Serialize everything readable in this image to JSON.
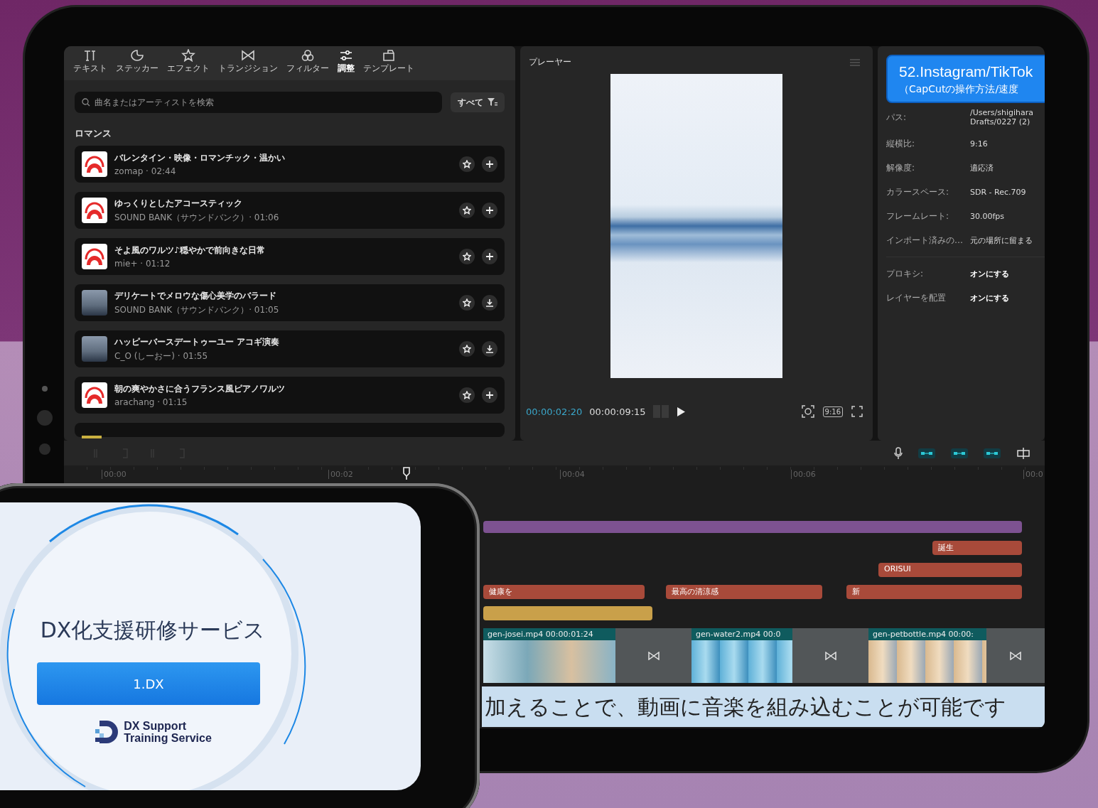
{
  "editor": {
    "tool_tabs": [
      {
        "label": "テキスト",
        "selected": false
      },
      {
        "label": "ステッカー",
        "selected": false
      },
      {
        "label": "エフェクト",
        "selected": false
      },
      {
        "label": "トランジション",
        "selected": false
      },
      {
        "label": "フィルター",
        "selected": false
      },
      {
        "label": "調整",
        "selected": true
      },
      {
        "label": "テンプレート",
        "selected": false
      }
    ],
    "search": {
      "placeholder": "曲名またはアーティストを検索"
    },
    "filter_button": "すべて",
    "category": "ロマンス",
    "tracks": [
      {
        "title": "バレンタイン・映像・ロマンチック・温かい",
        "meta": "zomap · 02:44",
        "kind": "logo",
        "downloaded": true
      },
      {
        "title": "ゆっくりとしたアコースティック",
        "meta": "SOUND BANK（サウンドバンク）· 01:06",
        "kind": "logo",
        "downloaded": true
      },
      {
        "title": "そよ風のワルツ♪穏やかで前向きな日常",
        "meta": "mie+ · 01:12",
        "kind": "logo",
        "downloaded": true
      },
      {
        "title": "デリケートでメロウな傷心美学のバラード",
        "meta": "SOUND BANK（サウンドバンク）· 01:05",
        "kind": "photo",
        "downloaded": false
      },
      {
        "title": "ハッピーバースデートゥーユー アコギ演奏",
        "meta": "C_O (しーおー) · 01:55",
        "kind": "photo",
        "downloaded": false
      },
      {
        "title": "朝の爽やかさに合うフランス風ピアノワルツ",
        "meta": "arachang · 01:15",
        "kind": "logo",
        "downloaded": true
      }
    ]
  },
  "player": {
    "title": "プレーヤー",
    "current_time": "00:00:02:20",
    "duration": "00:00:09:15",
    "ratio": "9:16"
  },
  "details": {
    "banner": {
      "title": "52.Instagram/TikTok",
      "subtitle": "（CapCutの操作方法/速度"
    },
    "path": {
      "label": "パス:",
      "value_lines": [
        "/Users/shigihara",
        "Drafts/0227 (2)"
      ]
    },
    "rows": [
      {
        "label": "縦横比:",
        "value": "9:16"
      },
      {
        "label": "解像度:",
        "value": "適応済"
      },
      {
        "label": "カラースペース:",
        "value": "SDR - Rec.709"
      },
      {
        "label": "フレームレート:",
        "value": "30.00fps"
      },
      {
        "label": "インポート済みの…",
        "value": "元の場所に留まる"
      }
    ],
    "toggles": [
      {
        "label": "プロキシ:",
        "value": "オンにする"
      },
      {
        "label": "レイヤーを配置",
        "value": "オンにする"
      }
    ]
  },
  "timeline": {
    "ruler": [
      "00:00",
      "00:02",
      "00:04",
      "00:06",
      "00:0"
    ],
    "text_clips": [
      {
        "label": "誕生"
      },
      {
        "label": "ORISUI"
      },
      {
        "label": "健康を"
      },
      {
        "label": "最高の清涼感"
      },
      {
        "label": "新"
      }
    ],
    "video_clips": [
      {
        "label": "gen-josei.mp4  00:00:01:24"
      },
      {
        "label": "gen-water2.mp4  00:0"
      },
      {
        "label": "gen-petbottle.mp4  00:00:"
      }
    ],
    "caption": "加えることで、動画に音楽を組み込むことが可能です"
  },
  "phone": {
    "title": "DX化支援研修サービス",
    "button": "1.DX",
    "logo_lines": [
      "DX Support",
      "Training Service"
    ]
  }
}
